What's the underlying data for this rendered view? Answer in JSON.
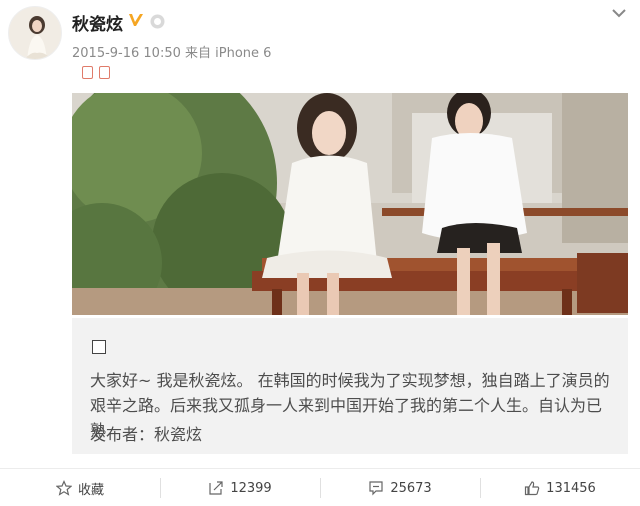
{
  "post": {
    "username": "秋瓷炫",
    "meta": "2015-9-16 10:50 来自 iPhone 6"
  },
  "card": {
    "text": "大家好~ 我是秋瓷炫。 在韩国的时候我为了实现梦想，独自踏上了演员的艰辛之路。后来我又孤身一人来到中国开始了我的第二个人生。自认为已熟",
    "publisher": "发布者：秋瓷炫"
  },
  "actions": {
    "favorite_label": "收藏",
    "repost_count": "12399",
    "comment_count": "25673",
    "like_count": "131456"
  },
  "colors": {
    "verified": "#f5a623",
    "accent_icon": "#e07b6a"
  },
  "icons": [
    "verified-icon",
    "vip-icon",
    "chevron-down-icon",
    "star-icon",
    "repost-icon",
    "comment-icon",
    "like-icon"
  ]
}
